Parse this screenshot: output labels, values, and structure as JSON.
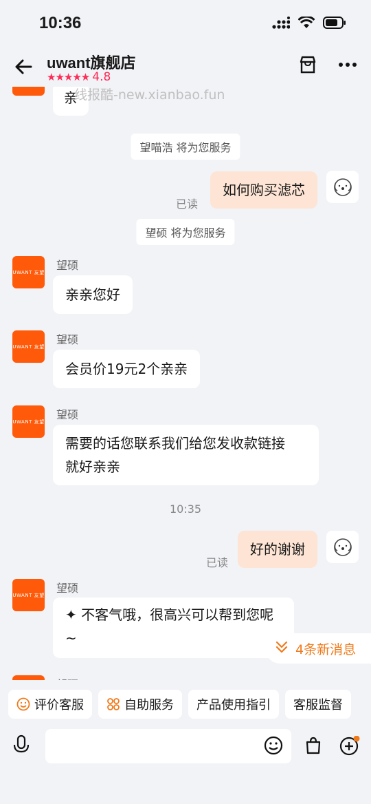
{
  "status": {
    "time": "10:36"
  },
  "header": {
    "title": "uwant旗舰店",
    "stars": "★★★★★",
    "rating": "4.8"
  },
  "watermark": "线报酷-new.xianbao.fun",
  "messages": {
    "top_partial": "亲",
    "system1": "望喵浩 将为您服务",
    "mine1": "如何购买滤芯",
    "read1": "已读",
    "system2": "望硕 将为您服务",
    "sender": "望硕",
    "store_avatar": "UWANT 友望",
    "m1": "亲亲您好",
    "m2": "会员价19元2个亲亲",
    "m3_l1": "需要的话您联系我们给您发收款链接",
    "m3_l2": "就好亲亲",
    "time": "10:35",
    "mine2": "好的谢谢",
    "read2": "已读",
    "m4": "✦ 不客气哦，很高兴可以帮到您呢~",
    "partial_sender": "望硕"
  },
  "new_messages": "4条新消息",
  "quick_actions": [
    "评价客服",
    "自助服务",
    "产品使用指引",
    "客服监督"
  ],
  "icons": [
    "back-arrow-icon",
    "shop-icon",
    "more-icon",
    "signal-icon",
    "wifi-icon",
    "battery-icon",
    "smile-icon",
    "grid-icon",
    "chevron-double-down-icon",
    "voice-icon",
    "emoji-icon",
    "bag-icon",
    "plus-icon"
  ],
  "colors": {
    "accent": "#f07a1a",
    "store_orange": "#ff5a0a",
    "my_bubble": "#fde4d4",
    "rating": "#ff2a55"
  }
}
